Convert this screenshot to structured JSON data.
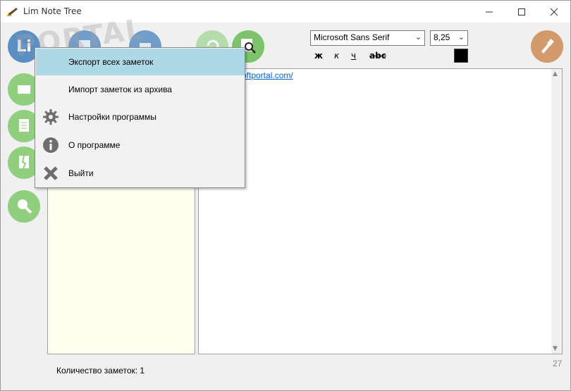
{
  "window": {
    "title": "Lim Note Tree"
  },
  "toolbar": {
    "font_name": "Microsoft Sans Serif",
    "font_size": "8,25",
    "bold_label": "ж",
    "italic_label": "к",
    "underline_label": "ч",
    "strike_label": "abc",
    "text_color": "#000000"
  },
  "watermark": "PORTAL",
  "editor": {
    "link_text": "oftportal.com/"
  },
  "status": {
    "notes_count": "Количество заметок: 1",
    "right_number": "27"
  },
  "menu": {
    "items": [
      {
        "label": "Экспорт всех заметок",
        "icon": "export-icon",
        "highlighted": true
      },
      {
        "label": "Импорт заметок из архива",
        "icon": "import-icon"
      },
      {
        "label": "Настройки программы",
        "icon": "gear-icon"
      },
      {
        "label": "О программе",
        "icon": "info-icon"
      },
      {
        "label": "Выйти",
        "icon": "close-icon"
      }
    ]
  },
  "colors": {
    "accent_blue": "#5b8fc4",
    "accent_green": "#8fcf7e",
    "accent_brown": "#d39a6b",
    "menu_highlight": "#aed8e6",
    "tree_bg": "#fffff0"
  }
}
